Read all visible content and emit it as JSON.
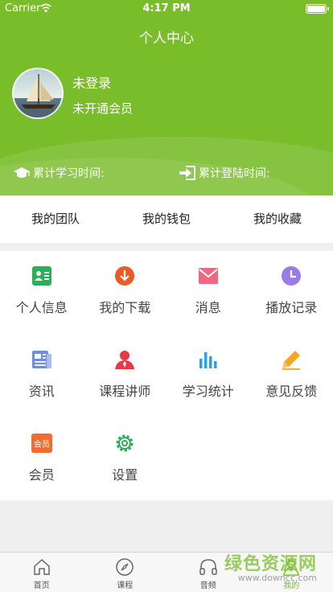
{
  "status_bar": {
    "carrier": "Carrier",
    "time": "4:17 PM"
  },
  "header": {
    "title": "个人中心",
    "user_name": "未登录",
    "vip_status": "未开通会员",
    "study_time_label": "累计学习时间:",
    "login_time_label": "累计登陆时间:"
  },
  "quick_tabs": [
    "我的团队",
    "我的钱包",
    "我的收藏"
  ],
  "grid": [
    {
      "label": "个人信息",
      "icon": "id-card-icon"
    },
    {
      "label": "我的下载",
      "icon": "download-icon"
    },
    {
      "label": "消息",
      "icon": "message-icon"
    },
    {
      "label": "播放记录",
      "icon": "history-clock-icon"
    },
    {
      "label": "资讯",
      "icon": "news-icon"
    },
    {
      "label": "课程讲师",
      "icon": "teacher-icon"
    },
    {
      "label": "学习统计",
      "icon": "statistics-icon"
    },
    {
      "label": "意见反馈",
      "icon": "feedback-pencil-icon"
    },
    {
      "label": "会员",
      "icon": "membership-icon",
      "badge": "会员"
    },
    {
      "label": "设置",
      "icon": "settings-gear-icon"
    }
  ],
  "tabbar": [
    {
      "label": "首页",
      "icon": "home-icon"
    },
    {
      "label": "课程",
      "icon": "compass-icon"
    },
    {
      "label": "音频",
      "icon": "headphones-icon"
    },
    {
      "label": "我的",
      "icon": "user-icon",
      "active": true
    }
  ],
  "watermark": {
    "text": "绿色资源网",
    "url": "www.downcc.com"
  },
  "colors": {
    "brand_green": "#79bd2b",
    "background": "#efefef"
  }
}
